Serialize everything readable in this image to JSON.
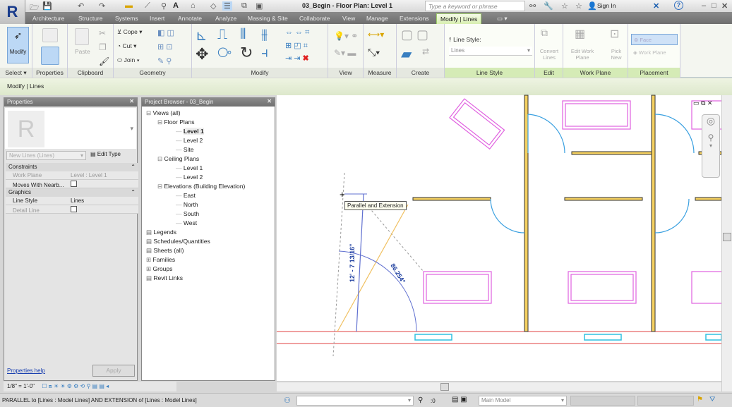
{
  "app": {
    "document_title": "03_Begin - Floor Plan: Level 1",
    "search_placeholder": "Type a keyword or phrase",
    "sign_in": "Sign In",
    "help": "?"
  },
  "tabs": [
    "Architecture",
    "Structure",
    "Systems",
    "Insert",
    "Annotate",
    "Analyze",
    "Massing & Site",
    "Collaborate",
    "View",
    "Manage",
    "Extensions",
    "Modify | Lines"
  ],
  "active_tab": "Modify | Lines",
  "ribbon": {
    "panels": [
      "Select",
      "Properties",
      "Clipboard",
      "Geometry",
      "Modify",
      "View",
      "Measure",
      "Create",
      "Line Style",
      "Edit",
      "Work Plane",
      "Placement"
    ],
    "modify_label": "Modify",
    "paste_label": "Paste",
    "cope_label": "Cope",
    "cut_label": "Cut",
    "join_label": "Join",
    "line_style_label": "Line Style:",
    "line_style_value": "Lines",
    "convert_lines": "Convert Lines",
    "edit_work_plane": "Edit Work Plane",
    "pick_new": "Pick New",
    "place": "Face",
    "work_plane": "Work Plane"
  },
  "options_bar": {
    "context": "Modify | Lines"
  },
  "properties": {
    "title": "Properties",
    "type_selector": "New Lines (Lines)",
    "edit_type": "Edit Type",
    "groups": [
      {
        "name": "Constraints",
        "rows": [
          {
            "label": "Work Plane",
            "value": "Level : Level 1"
          },
          {
            "label": "Moves With Nearb...",
            "value": "",
            "checkbox": true
          }
        ]
      },
      {
        "name": "Graphics",
        "rows": [
          {
            "label": "Line Style",
            "value": "Lines"
          },
          {
            "label": "Detail Line",
            "value": "",
            "checkbox": true
          }
        ]
      }
    ],
    "help_link": "Properties help",
    "apply": "Apply"
  },
  "project_browser": {
    "title": "Project Browser - 03_Begin",
    "items": [
      {
        "label": "Views (all)",
        "level": 0,
        "exp": "⊟"
      },
      {
        "label": "Floor Plans",
        "level": 1,
        "exp": "⊟"
      },
      {
        "label": "Level 1",
        "level": 2,
        "bold": true
      },
      {
        "label": "Level 2",
        "level": 2
      },
      {
        "label": "Site",
        "level": 2
      },
      {
        "label": "Ceiling Plans",
        "level": 1,
        "exp": "⊟"
      },
      {
        "label": "Level 1",
        "level": 2
      },
      {
        "label": "Level 2",
        "level": 2
      },
      {
        "label": "Elevations (Building Elevation)",
        "level": 1,
        "exp": "⊟"
      },
      {
        "label": "East",
        "level": 2
      },
      {
        "label": "North",
        "level": 2
      },
      {
        "label": "South",
        "level": 2
      },
      {
        "label": "West",
        "level": 2
      },
      {
        "label": "Legends",
        "level": 0
      },
      {
        "label": "Schedules/Quantities",
        "level": 0
      },
      {
        "label": "Sheets (all)",
        "level": 0
      },
      {
        "label": "Families",
        "level": 0,
        "exp": "⊞"
      },
      {
        "label": "Groups",
        "level": 0,
        "exp": "⊞"
      },
      {
        "label": "Revit Links",
        "level": 0
      }
    ]
  },
  "canvas": {
    "tooltip": "Parallel and Extension",
    "dimension_length": "12' - 7 13/16\"",
    "dimension_angle": "86.254°"
  },
  "view_control": {
    "scale": "1/8\" = 1'-0\""
  },
  "status": {
    "message": "PARALLEL  to [Lines : Model Lines] AND EXTENSION  of [Lines : Model Lines]",
    "selection_count": ":0",
    "workset": "Main Model"
  },
  "colors": {
    "desk": "#e060e0",
    "door": "#3aa0e0",
    "wall_fill": "#f0c040",
    "sketch": "#6070d0",
    "window": "#30c0e0",
    "grid": "#e04040",
    "ribbon_active": "#d8efb0"
  }
}
